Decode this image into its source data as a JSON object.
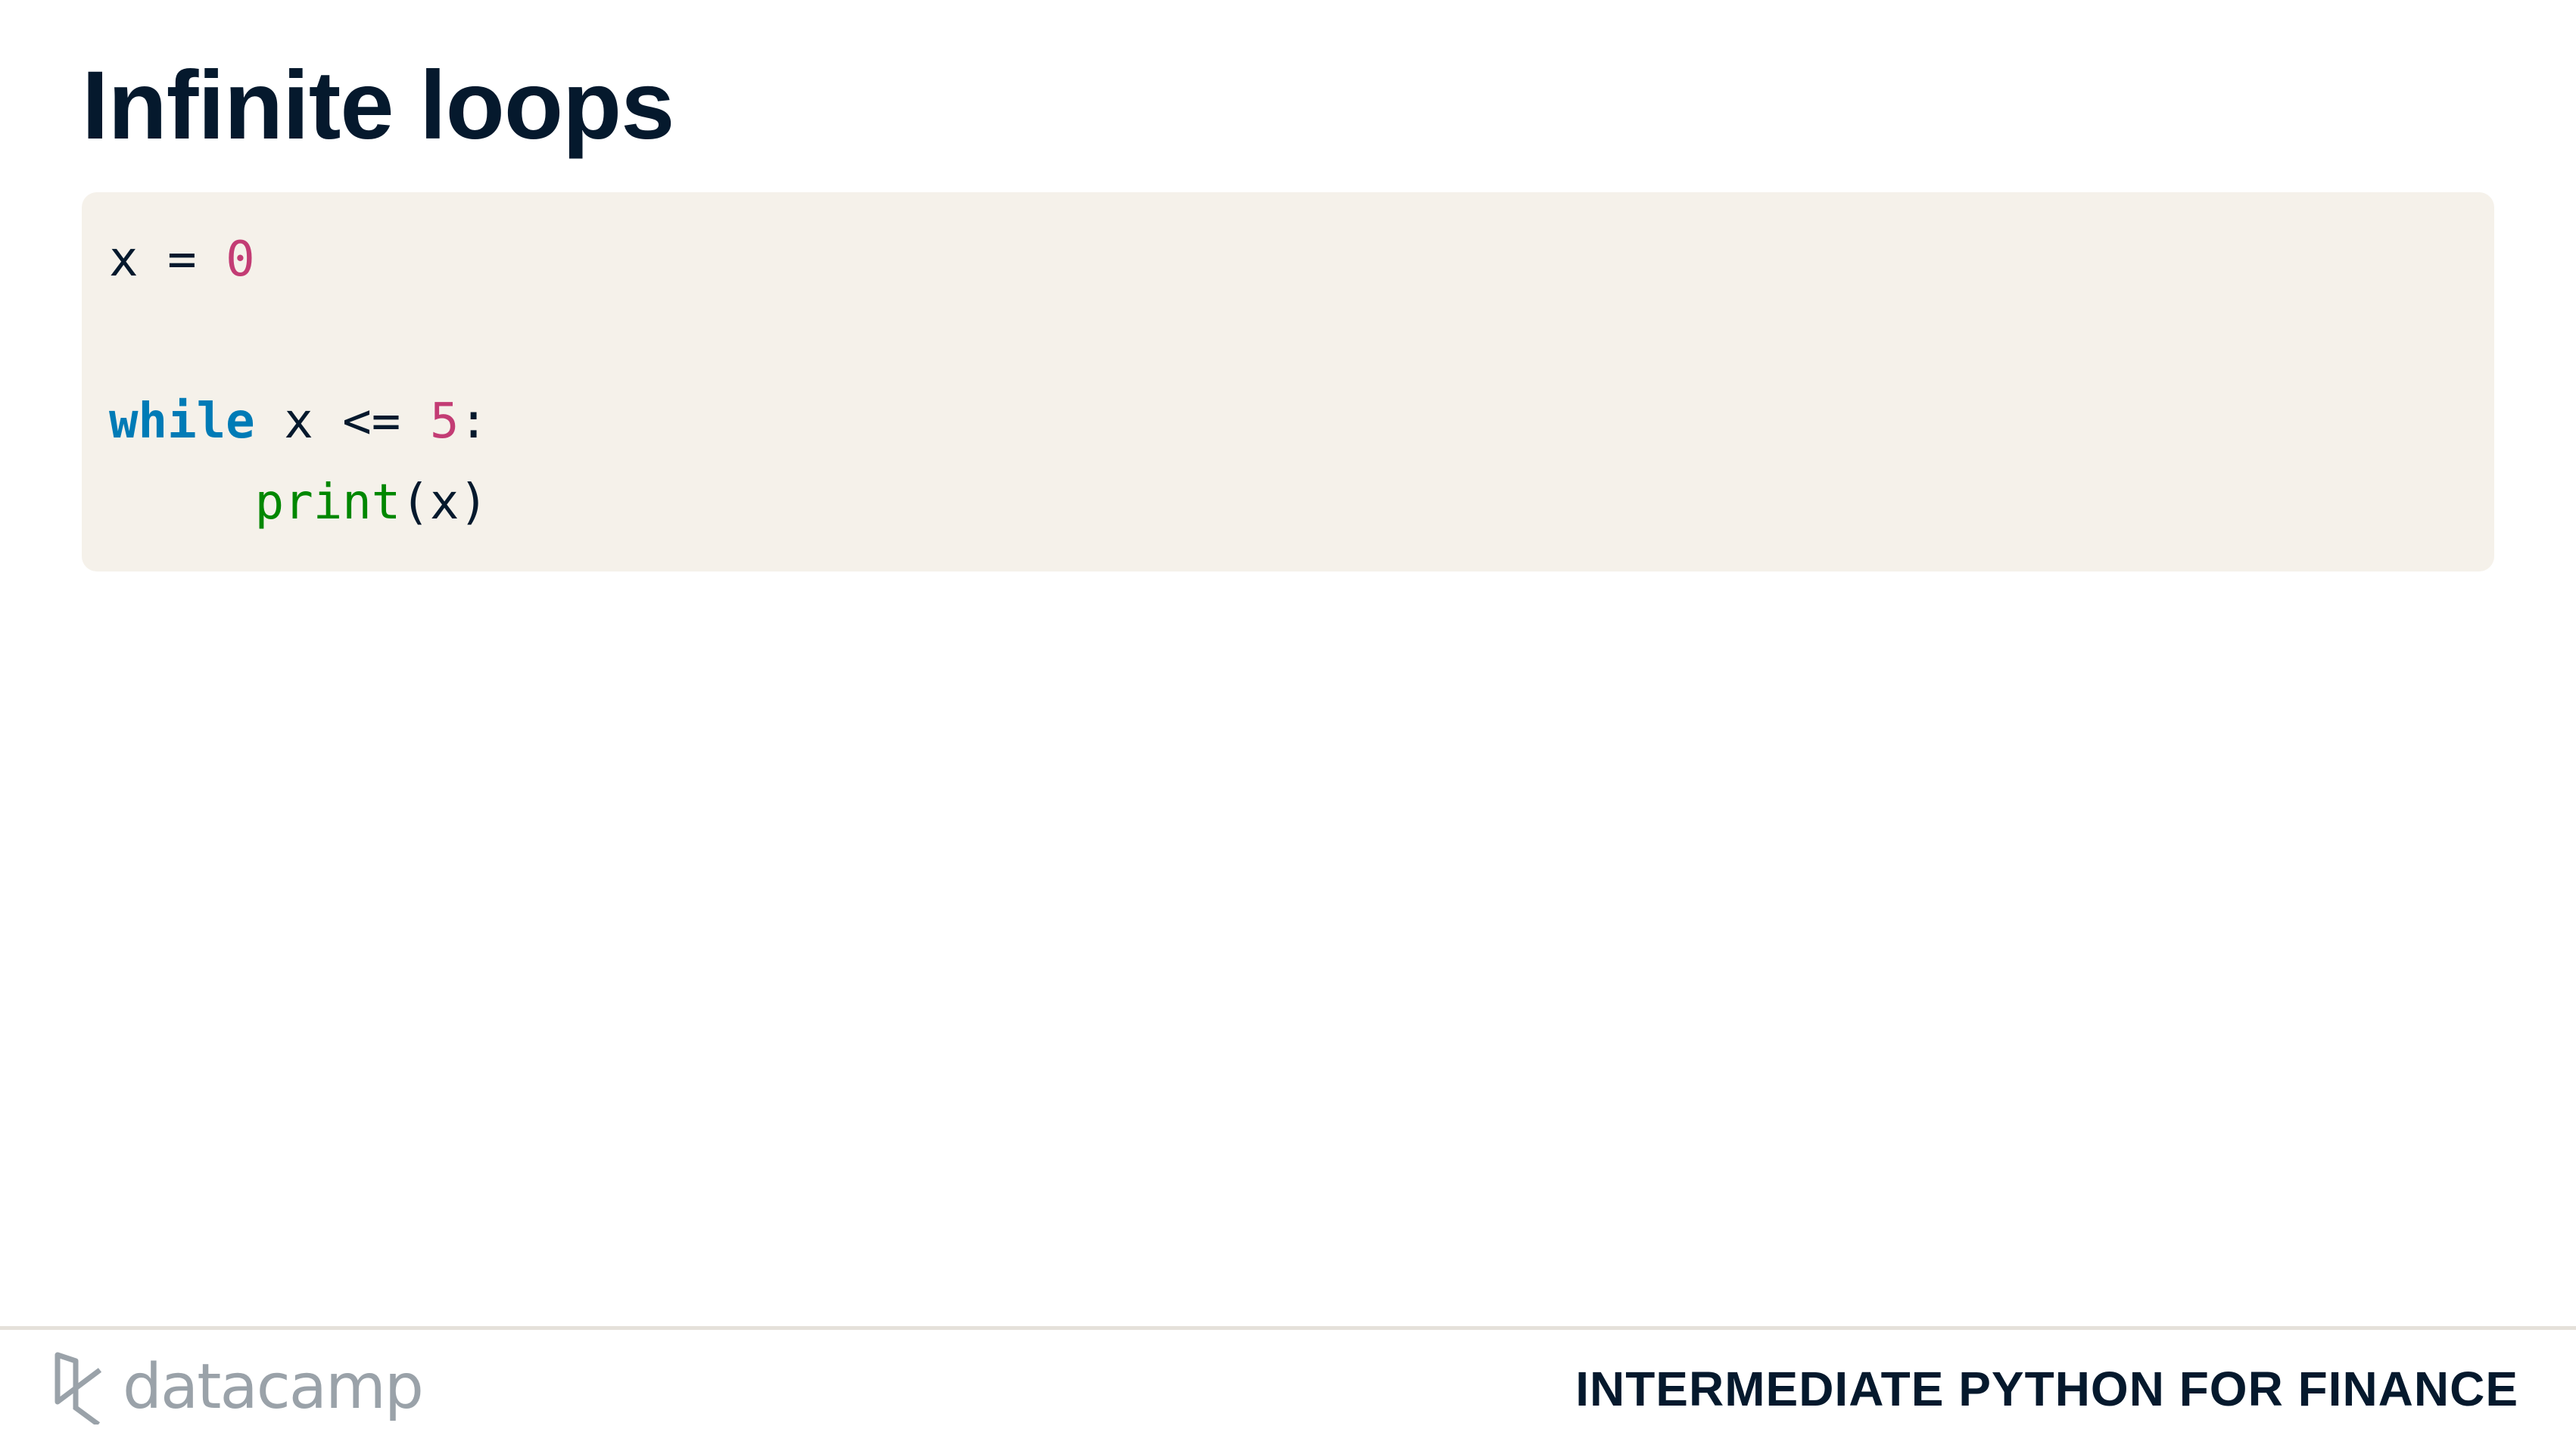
{
  "slide": {
    "title": "Infinite loops"
  },
  "code": {
    "line1": {
      "var": "x",
      "op": "=",
      "num": "0"
    },
    "line2": {
      "keyword": "while",
      "var": "x",
      "op": "<=",
      "num": "5",
      "colon": ":"
    },
    "line3": {
      "func": "print",
      "args": "(x)"
    }
  },
  "colors": {
    "keyword": "#007bb6",
    "number": "#c33c74",
    "function": "#008700",
    "code_bg": "#f5f1ea",
    "text": "#05192d"
  },
  "footer": {
    "logo": "datacamp",
    "course": "INTERMEDIATE PYTHON FOR FINANCE"
  }
}
